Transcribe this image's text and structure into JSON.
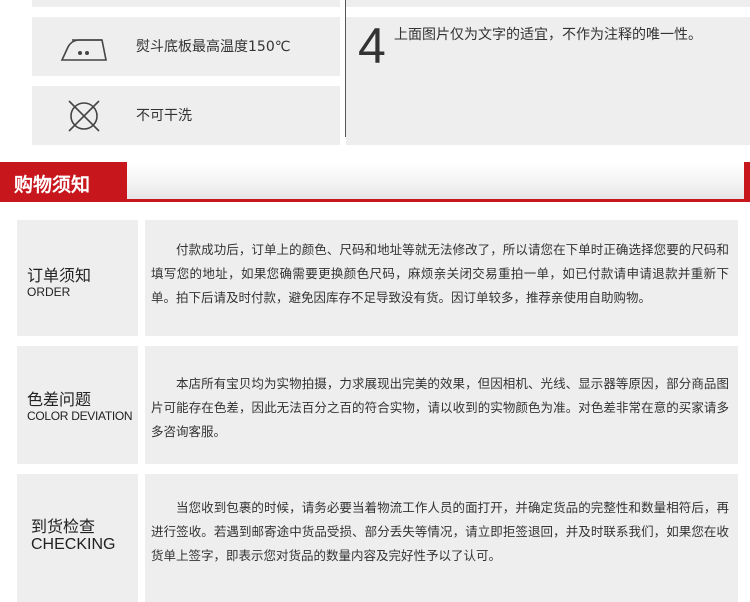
{
  "care": {
    "items": [
      {
        "icon": "iron-icon",
        "label": "熨斗底板最高温度150℃"
      },
      {
        "icon": "no-tumble-dry-icon",
        "label": "不可干洗"
      }
    ],
    "note": {
      "number": "4",
      "text": "上面图片仅为文字的适宜，不作为注释的唯一性。"
    }
  },
  "section": {
    "title": "购物须知",
    "accent_color": "#c8161d"
  },
  "notices": [
    {
      "title_zh": "订单须知",
      "title_en": "ORDER",
      "body": "付款成功后，订单上的颜色、尺码和地址等就无法修改了，所以请您在下单时正确选择您要的尺码和填写您的地址，如果您确需要更换颜色尺码，麻烦亲关闭交易重拍一单，如已付款请申请退款并重新下单。拍下后请及时付款，避免因库存不足导致没有货。因订单较多，推荐亲使用自助购物。"
    },
    {
      "title_zh": "色差问题",
      "title_en": "COLOR DEVIATION",
      "body": "本店所有宝贝均为实物拍摄，力求展现出完美的效果，但因相机、光线、显示器等原因，部分商品图片可能存在色差，因此无法百分之百的符合实物，请以收到的实物颜色为准。对色差非常在意的买家请多多咨询客服。"
    },
    {
      "title_zh": "到货检查",
      "title_en": "CHECKING",
      "body": "当您收到包裹的时候，请务必要当着物流工作人员的面打开，并确定货品的完整性和数量相符后，再进行签收。若遇到邮寄途中货品受损、部分丢失等情况，请立即拒签退回，并及时联系我们，如果您在收货单上签字，即表示您对货品的数量内容及完好性予以了认可。"
    }
  ]
}
